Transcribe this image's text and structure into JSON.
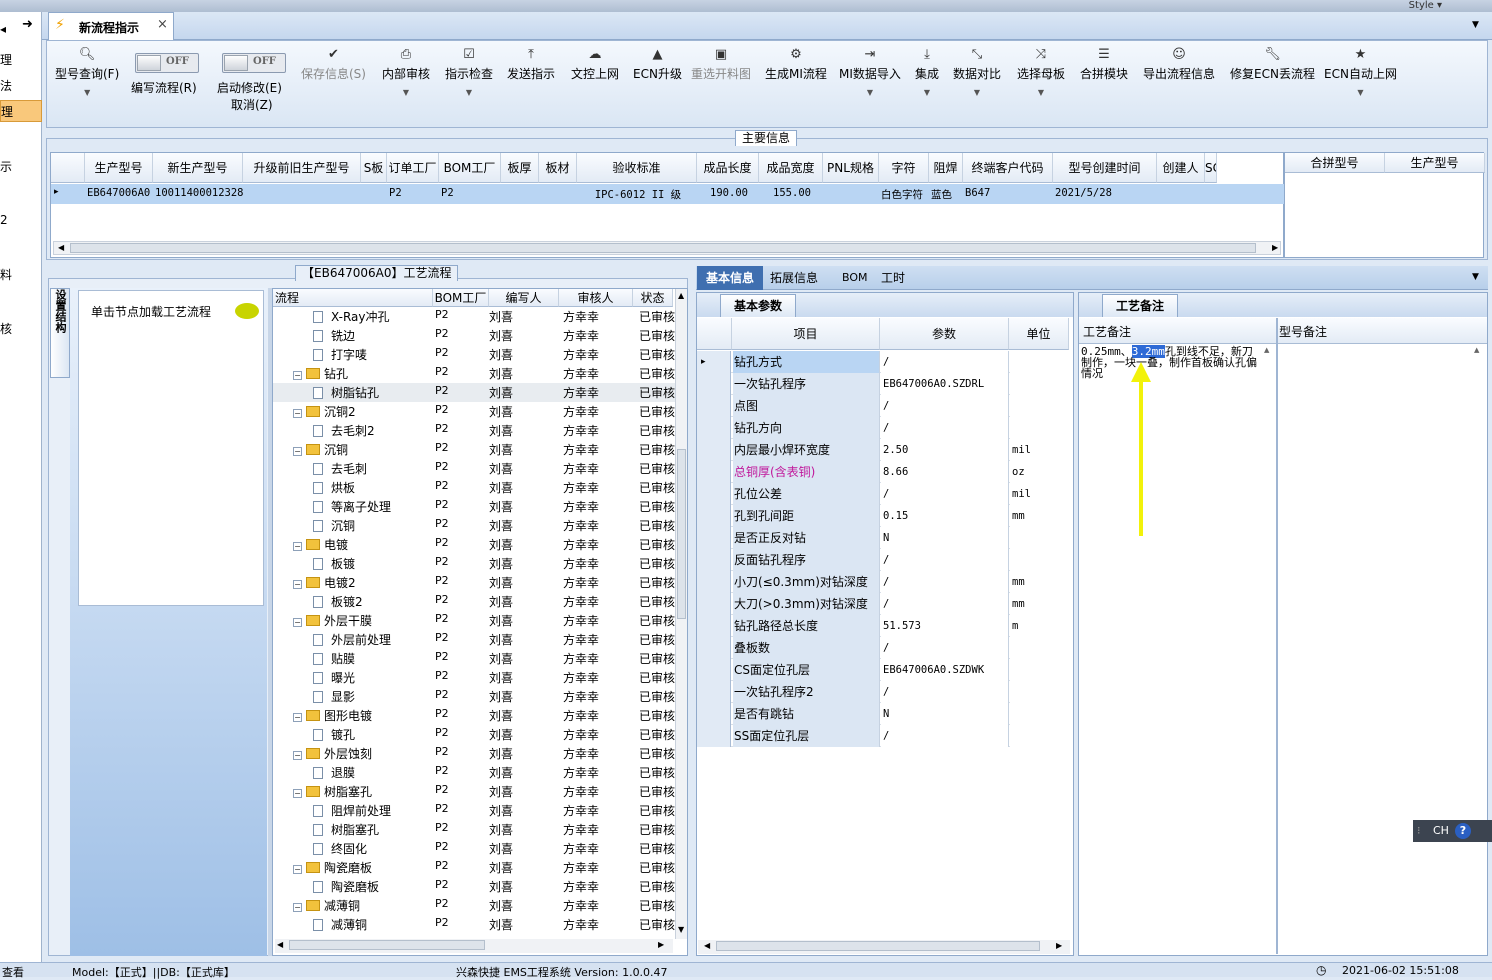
{
  "window": {
    "style_label": "Style ▾"
  },
  "left_nav": [
    "理",
    "法",
    "理",
    "示",
    "2",
    "料",
    "核"
  ],
  "tabs": [
    {
      "label": "新流程指示",
      "close": "×"
    }
  ],
  "toolbar": {
    "query": "型号查询(F)",
    "edit_flow": "编写流程(R)",
    "start_modify": "启动修改(E)",
    "cancel": "取消(Z)",
    "toggle_off": "OFF",
    "save": "保存信息(S)",
    "internal_review": "内部审核",
    "indicator_check": "指示检查",
    "send": "发送指示",
    "upload": "文控上网",
    "ecn_up": "ECN升级",
    "reselect": "重选开料图",
    "gen_mi": "生成MI流程",
    "mi_import": "MI数据导入",
    "integrate": "集成",
    "compare": "数据对比",
    "select_parent": "选择母板",
    "merge": "合拼模块",
    "export": "导出流程信息",
    "repair": "修复ECN丢流程",
    "ecn_auto": "ECN自动上网"
  },
  "main_info": {
    "title": "主要信息",
    "columns": [
      "生产型号",
      "新生产型号",
      "升级前旧生产型号",
      "S板",
      "订单工厂",
      "BOM工厂",
      "板厚",
      "板材",
      "验收标准",
      "成品长度",
      "成品宽度",
      "PNL规格",
      "字符",
      "阻焊",
      "终端客户代码",
      "型号创建时间",
      "创建人",
      "SC"
    ],
    "row": [
      "EB647006A0",
      "10011400012328",
      "",
      "",
      "P2",
      "P2",
      "",
      "",
      "IPC-6012 II 级",
      "190.00",
      "155.00",
      "",
      "白色字符",
      "蓝色",
      "B647",
      "2021/5/28",
      "",
      ""
    ],
    "merge_columns": [
      "合拼型号",
      "生产型号"
    ]
  },
  "process": {
    "title": "【EB647006A0】工艺流程",
    "side_tab": "设置结构",
    "hint": "单击节点加载工艺流程",
    "columns": [
      "流程",
      "BOM工厂",
      "编写人",
      "审核人",
      "状态"
    ],
    "rows": [
      {
        "name": "X-Ray冲孔",
        "level": 2,
        "bom": "P2",
        "writer": "刘喜",
        "reviewer": "方幸幸",
        "status": "已审核"
      },
      {
        "name": "铣边",
        "level": 2,
        "bom": "P2",
        "writer": "刘喜",
        "reviewer": "方幸幸",
        "status": "已审核"
      },
      {
        "name": "打字唛",
        "level": 2,
        "bom": "P2",
        "writer": "刘喜",
        "reviewer": "方幸幸",
        "status": "已审核"
      },
      {
        "name": "钻孔",
        "level": 1,
        "bom": "P2",
        "writer": "刘喜",
        "reviewer": "方幸幸",
        "status": "已审核"
      },
      {
        "name": "树脂钻孔",
        "level": 2,
        "bom": "P2",
        "writer": "刘喜",
        "reviewer": "方幸幸",
        "status": "已审核"
      },
      {
        "name": "沉铜2",
        "level": 1,
        "bom": "P2",
        "writer": "刘喜",
        "reviewer": "方幸幸",
        "status": "已审核"
      },
      {
        "name": "去毛刺2",
        "level": 2,
        "bom": "P2",
        "writer": "刘喜",
        "reviewer": "方幸幸",
        "status": "已审核"
      },
      {
        "name": "沉铜",
        "level": 1,
        "bom": "P2",
        "writer": "刘喜",
        "reviewer": "方幸幸",
        "status": "已审核"
      },
      {
        "name": "去毛刺",
        "level": 2,
        "bom": "P2",
        "writer": "刘喜",
        "reviewer": "方幸幸",
        "status": "已审核"
      },
      {
        "name": "烘板",
        "level": 2,
        "bom": "P2",
        "writer": "刘喜",
        "reviewer": "方幸幸",
        "status": "已审核"
      },
      {
        "name": "等离子处理",
        "level": 2,
        "bom": "P2",
        "writer": "刘喜",
        "reviewer": "方幸幸",
        "status": "已审核"
      },
      {
        "name": "沉铜",
        "level": 2,
        "bom": "P2",
        "writer": "刘喜",
        "reviewer": "方幸幸",
        "status": "已审核"
      },
      {
        "name": "电镀",
        "level": 1,
        "bom": "P2",
        "writer": "刘喜",
        "reviewer": "方幸幸",
        "status": "已审核"
      },
      {
        "name": "板镀",
        "level": 2,
        "bom": "P2",
        "writer": "刘喜",
        "reviewer": "方幸幸",
        "status": "已审核"
      },
      {
        "name": "电镀2",
        "level": 1,
        "bom": "P2",
        "writer": "刘喜",
        "reviewer": "方幸幸",
        "status": "已审核"
      },
      {
        "name": "板镀2",
        "level": 2,
        "bom": "P2",
        "writer": "刘喜",
        "reviewer": "方幸幸",
        "status": "已审核"
      },
      {
        "name": "外层干膜",
        "level": 1,
        "bom": "P2",
        "writer": "刘喜",
        "reviewer": "方幸幸",
        "status": "已审核"
      },
      {
        "name": "外层前处理",
        "level": 2,
        "bom": "P2",
        "writer": "刘喜",
        "reviewer": "方幸幸",
        "status": "已审核"
      },
      {
        "name": "贴膜",
        "level": 2,
        "bom": "P2",
        "writer": "刘喜",
        "reviewer": "方幸幸",
        "status": "已审核"
      },
      {
        "name": "曝光",
        "level": 2,
        "bom": "P2",
        "writer": "刘喜",
        "reviewer": "方幸幸",
        "status": "已审核"
      },
      {
        "name": "显影",
        "level": 2,
        "bom": "P2",
        "writer": "刘喜",
        "reviewer": "方幸幸",
        "status": "已审核"
      },
      {
        "name": "图形电镀",
        "level": 1,
        "bom": "P2",
        "writer": "刘喜",
        "reviewer": "方幸幸",
        "status": "已审核"
      },
      {
        "name": "镀孔",
        "level": 2,
        "bom": "P2",
        "writer": "刘喜",
        "reviewer": "方幸幸",
        "status": "已审核"
      },
      {
        "name": "外层蚀刻",
        "level": 1,
        "bom": "P2",
        "writer": "刘喜",
        "reviewer": "方幸幸",
        "status": "已审核"
      },
      {
        "name": "退膜",
        "level": 2,
        "bom": "P2",
        "writer": "刘喜",
        "reviewer": "方幸幸",
        "status": "已审核"
      },
      {
        "name": "树脂塞孔",
        "level": 1,
        "bom": "P2",
        "writer": "刘喜",
        "reviewer": "方幸幸",
        "status": "已审核"
      },
      {
        "name": "阻焊前处理",
        "level": 2,
        "bom": "P2",
        "writer": "刘喜",
        "reviewer": "方幸幸",
        "status": "已审核"
      },
      {
        "name": "树脂塞孔",
        "level": 2,
        "bom": "P2",
        "writer": "刘喜",
        "reviewer": "方幸幸",
        "status": "已审核"
      },
      {
        "name": "终固化",
        "level": 2,
        "bom": "P2",
        "writer": "刘喜",
        "reviewer": "方幸幸",
        "status": "已审核"
      },
      {
        "name": "陶瓷磨板",
        "level": 1,
        "bom": "P2",
        "writer": "刘喜",
        "reviewer": "方幸幸",
        "status": "已审核"
      },
      {
        "name": "陶瓷磨板",
        "level": 2,
        "bom": "P2",
        "writer": "刘喜",
        "reviewer": "方幸幸",
        "status": "已审核"
      },
      {
        "name": "减薄铜",
        "level": 1,
        "bom": "P2",
        "writer": "刘喜",
        "reviewer": "方幸幸",
        "status": "已审核"
      },
      {
        "name": "减薄铜",
        "level": 2,
        "bom": "P2",
        "writer": "刘喜",
        "reviewer": "方幸幸",
        "status": "已审核"
      }
    ]
  },
  "detail_tabs": [
    "基本信息",
    "拓展信息",
    "BOM",
    "工时"
  ],
  "basic_params": {
    "title": "基本参数",
    "columns": [
      "项目",
      "参数",
      "单位"
    ],
    "rows": [
      {
        "k": "钻孔方式",
        "v": "/",
        "u": ""
      },
      {
        "k": "一次钻孔程序",
        "v": "EB647006A0.SZDRL",
        "u": ""
      },
      {
        "k": "点图",
        "v": "/",
        "u": ""
      },
      {
        "k": "钻孔方向",
        "v": "/",
        "u": ""
      },
      {
        "k": "内层最小焊环宽度",
        "v": "2.50",
        "u": "mil"
      },
      {
        "k": "总铜厚(含表铜)",
        "v": "8.66",
        "u": "oz",
        "hl": true
      },
      {
        "k": "孔位公差",
        "v": "/",
        "u": "mil"
      },
      {
        "k": "孔到孔间距",
        "v": "0.15",
        "u": "mm"
      },
      {
        "k": "是否正反对钻",
        "v": "N",
        "u": ""
      },
      {
        "k": "反面钻孔程序",
        "v": "/",
        "u": ""
      },
      {
        "k": "小刀(≤0.3mm)对钻深度",
        "v": "/",
        "u": "mm"
      },
      {
        "k": "大刀(>0.3mm)对钻深度",
        "v": "/",
        "u": "mm"
      },
      {
        "k": "钻孔路径总长度",
        "v": "51.573",
        "u": "m"
      },
      {
        "k": "叠板数",
        "v": "/",
        "u": ""
      },
      {
        "k": "CS面定位孔层",
        "v": "EB647006A0.SZDWK",
        "u": ""
      },
      {
        "k": "一次钻孔程序2",
        "v": "/",
        "u": ""
      },
      {
        "k": "是否有跳钻",
        "v": "N",
        "u": ""
      },
      {
        "k": "SS面定位孔层",
        "v": "/",
        "u": ""
      }
    ]
  },
  "notes": {
    "title": "工艺备注",
    "col1": "工艺备注",
    "col2": "型号备注",
    "text_a": "0.25mm、",
    "text_sel": "3.2mm",
    "text_b": "孔到线不足，新刀制作，一块一叠，制作首板确认孔偏情况"
  },
  "ime": {
    "label": "CH"
  },
  "status_bar": {
    "left": "查看",
    "model": "Model:【正式】||DB:【正式库】",
    "system": "兴森快捷 EMS工程系统 Version: 1.0.0.47",
    "time": "2021-06-02 15:51:08"
  }
}
